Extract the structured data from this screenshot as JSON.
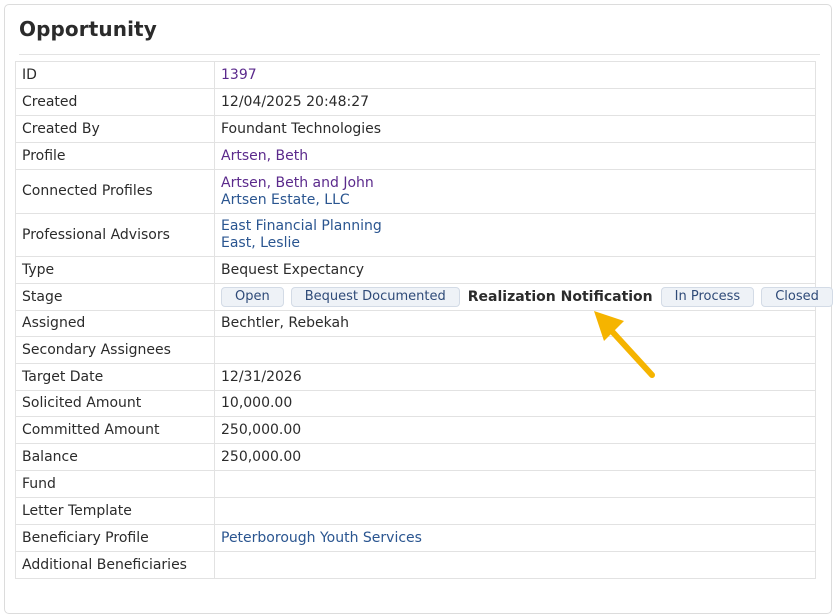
{
  "panel": {
    "title": "Opportunity"
  },
  "rows": {
    "id": {
      "label": "ID",
      "value": "1397"
    },
    "created": {
      "label": "Created",
      "value": "12/04/2025 20:48:27"
    },
    "created_by": {
      "label": "Created By",
      "value": "Foundant Technologies"
    },
    "profile": {
      "label": "Profile",
      "value": "Artsen, Beth"
    },
    "connected_profiles": {
      "label": "Connected Profiles",
      "values": [
        "Artsen, Beth and John",
        "Artsen Estate, LLC"
      ]
    },
    "professional_advisors": {
      "label": "Professional Advisors",
      "values": [
        "East Financial Planning",
        "East, Leslie"
      ]
    },
    "type": {
      "label": "Type",
      "value": "Bequest Expectancy"
    },
    "stage": {
      "label": "Stage",
      "buttons_before": [
        "Open",
        "Bequest Documented"
      ],
      "current": "Realization Notification",
      "buttons_after": [
        "In Process",
        "Closed"
      ]
    },
    "assigned": {
      "label": "Assigned",
      "value": "Bechtler, Rebekah"
    },
    "secondary_assignees": {
      "label": "Secondary Assignees",
      "value": ""
    },
    "target_date": {
      "label": "Target Date",
      "value": "12/31/2026"
    },
    "solicited_amount": {
      "label": "Solicited Amount",
      "value": "10,000.00"
    },
    "committed_amount": {
      "label": "Committed Amount",
      "value": "250,000.00"
    },
    "balance": {
      "label": "Balance",
      "value": "250,000.00"
    },
    "fund": {
      "label": "Fund",
      "value": ""
    },
    "letter_template": {
      "label": "Letter Template",
      "value": ""
    },
    "beneficiary_profile": {
      "label": "Beneficiary Profile",
      "value": "Peterborough Youth Services"
    },
    "additional_beneficiaries": {
      "label": "Additional Beneficiaries",
      "value": ""
    }
  },
  "colors": {
    "link_purple": "#5b2a8c",
    "link_blue": "#2a5590",
    "arrow": "#f5b400"
  },
  "annotation": {
    "icon": "arrow-annotation-icon"
  }
}
